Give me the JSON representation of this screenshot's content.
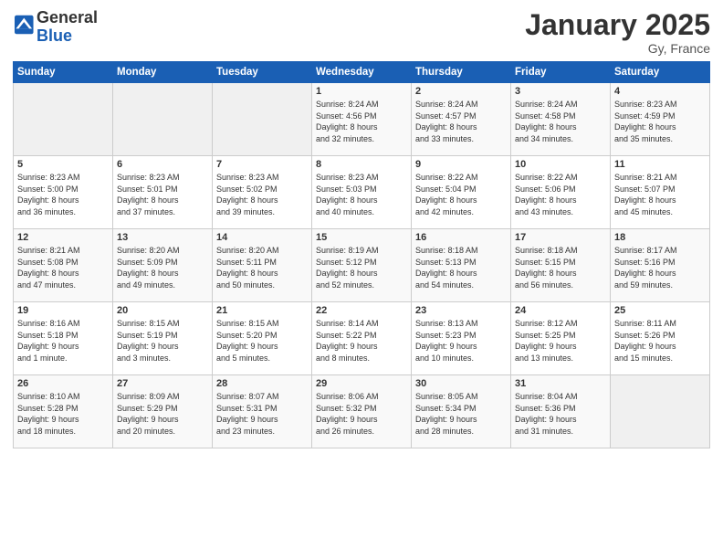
{
  "header": {
    "logo_general": "General",
    "logo_blue": "Blue",
    "month_title": "January 2025",
    "location": "Gy, France"
  },
  "weekdays": [
    "Sunday",
    "Monday",
    "Tuesday",
    "Wednesday",
    "Thursday",
    "Friday",
    "Saturday"
  ],
  "weeks": [
    [
      {
        "day": "",
        "info": ""
      },
      {
        "day": "",
        "info": ""
      },
      {
        "day": "",
        "info": ""
      },
      {
        "day": "1",
        "info": "Sunrise: 8:24 AM\nSunset: 4:56 PM\nDaylight: 8 hours\nand 32 minutes."
      },
      {
        "day": "2",
        "info": "Sunrise: 8:24 AM\nSunset: 4:57 PM\nDaylight: 8 hours\nand 33 minutes."
      },
      {
        "day": "3",
        "info": "Sunrise: 8:24 AM\nSunset: 4:58 PM\nDaylight: 8 hours\nand 34 minutes."
      },
      {
        "day": "4",
        "info": "Sunrise: 8:23 AM\nSunset: 4:59 PM\nDaylight: 8 hours\nand 35 minutes."
      }
    ],
    [
      {
        "day": "5",
        "info": "Sunrise: 8:23 AM\nSunset: 5:00 PM\nDaylight: 8 hours\nand 36 minutes."
      },
      {
        "day": "6",
        "info": "Sunrise: 8:23 AM\nSunset: 5:01 PM\nDaylight: 8 hours\nand 37 minutes."
      },
      {
        "day": "7",
        "info": "Sunrise: 8:23 AM\nSunset: 5:02 PM\nDaylight: 8 hours\nand 39 minutes."
      },
      {
        "day": "8",
        "info": "Sunrise: 8:23 AM\nSunset: 5:03 PM\nDaylight: 8 hours\nand 40 minutes."
      },
      {
        "day": "9",
        "info": "Sunrise: 8:22 AM\nSunset: 5:04 PM\nDaylight: 8 hours\nand 42 minutes."
      },
      {
        "day": "10",
        "info": "Sunrise: 8:22 AM\nSunset: 5:06 PM\nDaylight: 8 hours\nand 43 minutes."
      },
      {
        "day": "11",
        "info": "Sunrise: 8:21 AM\nSunset: 5:07 PM\nDaylight: 8 hours\nand 45 minutes."
      }
    ],
    [
      {
        "day": "12",
        "info": "Sunrise: 8:21 AM\nSunset: 5:08 PM\nDaylight: 8 hours\nand 47 minutes."
      },
      {
        "day": "13",
        "info": "Sunrise: 8:20 AM\nSunset: 5:09 PM\nDaylight: 8 hours\nand 49 minutes."
      },
      {
        "day": "14",
        "info": "Sunrise: 8:20 AM\nSunset: 5:11 PM\nDaylight: 8 hours\nand 50 minutes."
      },
      {
        "day": "15",
        "info": "Sunrise: 8:19 AM\nSunset: 5:12 PM\nDaylight: 8 hours\nand 52 minutes."
      },
      {
        "day": "16",
        "info": "Sunrise: 8:18 AM\nSunset: 5:13 PM\nDaylight: 8 hours\nand 54 minutes."
      },
      {
        "day": "17",
        "info": "Sunrise: 8:18 AM\nSunset: 5:15 PM\nDaylight: 8 hours\nand 56 minutes."
      },
      {
        "day": "18",
        "info": "Sunrise: 8:17 AM\nSunset: 5:16 PM\nDaylight: 8 hours\nand 59 minutes."
      }
    ],
    [
      {
        "day": "19",
        "info": "Sunrise: 8:16 AM\nSunset: 5:18 PM\nDaylight: 9 hours\nand 1 minute."
      },
      {
        "day": "20",
        "info": "Sunrise: 8:15 AM\nSunset: 5:19 PM\nDaylight: 9 hours\nand 3 minutes."
      },
      {
        "day": "21",
        "info": "Sunrise: 8:15 AM\nSunset: 5:20 PM\nDaylight: 9 hours\nand 5 minutes."
      },
      {
        "day": "22",
        "info": "Sunrise: 8:14 AM\nSunset: 5:22 PM\nDaylight: 9 hours\nand 8 minutes."
      },
      {
        "day": "23",
        "info": "Sunrise: 8:13 AM\nSunset: 5:23 PM\nDaylight: 9 hours\nand 10 minutes."
      },
      {
        "day": "24",
        "info": "Sunrise: 8:12 AM\nSunset: 5:25 PM\nDaylight: 9 hours\nand 13 minutes."
      },
      {
        "day": "25",
        "info": "Sunrise: 8:11 AM\nSunset: 5:26 PM\nDaylight: 9 hours\nand 15 minutes."
      }
    ],
    [
      {
        "day": "26",
        "info": "Sunrise: 8:10 AM\nSunset: 5:28 PM\nDaylight: 9 hours\nand 18 minutes."
      },
      {
        "day": "27",
        "info": "Sunrise: 8:09 AM\nSunset: 5:29 PM\nDaylight: 9 hours\nand 20 minutes."
      },
      {
        "day": "28",
        "info": "Sunrise: 8:07 AM\nSunset: 5:31 PM\nDaylight: 9 hours\nand 23 minutes."
      },
      {
        "day": "29",
        "info": "Sunrise: 8:06 AM\nSunset: 5:32 PM\nDaylight: 9 hours\nand 26 minutes."
      },
      {
        "day": "30",
        "info": "Sunrise: 8:05 AM\nSunset: 5:34 PM\nDaylight: 9 hours\nand 28 minutes."
      },
      {
        "day": "31",
        "info": "Sunrise: 8:04 AM\nSunset: 5:36 PM\nDaylight: 9 hours\nand 31 minutes."
      },
      {
        "day": "",
        "info": ""
      }
    ]
  ]
}
